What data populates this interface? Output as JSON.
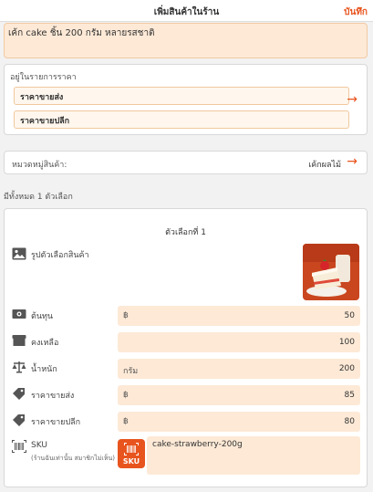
{
  "header": {
    "title": "เพิ่มสินค้าในร้าน",
    "save_label": "บันทึก"
  },
  "product_name": "เค้ก cake ชิ้น 200 กรัม หลายรสชาติ",
  "price_section": {
    "title": "อยู่ในรายการราคา",
    "wholesale_label": "ราคาขายส่ง",
    "retail_label": "ราคาขายปลีก"
  },
  "category": {
    "label": "หมวดหมู่สินค้า:",
    "value": "เค้กผลไม้"
  },
  "options_summary": "มีทั้งหมด 1 ตัวเลือก",
  "option": {
    "title": "ตัวเลือกที่ 1",
    "image_label": "รูปตัวเลือกสินค้า",
    "rows": [
      {
        "label": "ต้นทุน",
        "prefix": "฿",
        "value": "50",
        "icon": "money-icon"
      },
      {
        "label": "คงเหลือ",
        "prefix": "",
        "value": "100",
        "icon": "box-icon"
      },
      {
        "label": "น้ำหนัก",
        "prefix": "กรัม",
        "value": "200",
        "icon": "scale-icon"
      },
      {
        "label": "ราคาขายส่ง",
        "prefix": "฿",
        "value": "85",
        "icon": "tag-icon"
      },
      {
        "label": "ราคาขายปลีก",
        "prefix": "฿",
        "value": "80",
        "icon": "tag-icon"
      }
    ],
    "sku_label": "SKU",
    "sku_sub": "(ร้านฉันเท่านั้น สมาชิกไม่เห็น)",
    "sku_button": "SKU",
    "sku_value": "cake-strawberry-200g"
  },
  "colors": {
    "accent": "#e8541e",
    "field_bg": "#fde9d6"
  }
}
